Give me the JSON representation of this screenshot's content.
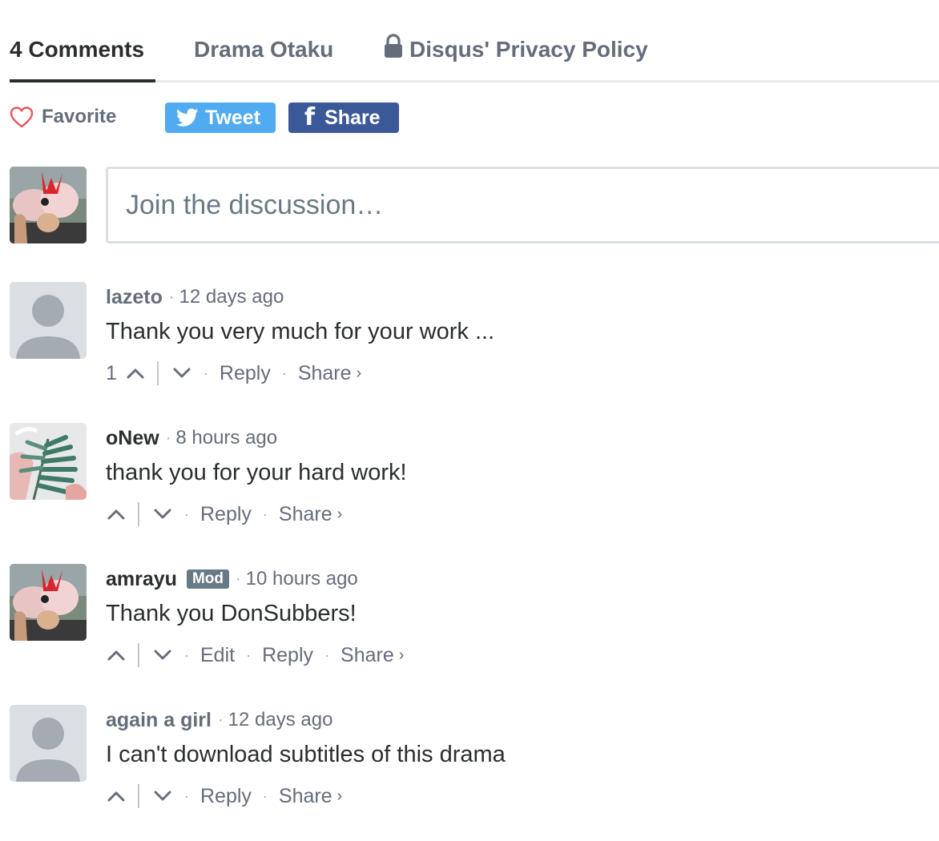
{
  "nav": {
    "comments_tab": "4 Comments",
    "community_tab": "Drama Otaku",
    "privacy_tab": "Disqus' Privacy Policy"
  },
  "actions": {
    "favorite": "Favorite",
    "tweet": "Tweet",
    "share": "Share"
  },
  "composer": {
    "placeholder": "Join the discussion…"
  },
  "comments": [
    {
      "author": "lazeto",
      "time": "12 days ago",
      "body": "Thank you very much for your work ...",
      "votes": "1",
      "reply": "Reply",
      "share": "Share",
      "share_chevron": "›"
    },
    {
      "author": "oNew",
      "time": "8 hours ago",
      "body": "thank you for your hard work!",
      "reply": "Reply",
      "share": "Share",
      "share_chevron": "›"
    },
    {
      "author": "amrayu",
      "badge": "Mod",
      "time": "10 hours ago",
      "body": "Thank you DonSubbers!",
      "edit": "Edit",
      "reply": "Reply",
      "share": "Share",
      "share_chevron": "›"
    },
    {
      "author": "again a girl",
      "time": "12 days ago",
      "body": "I can't download subtitles of this drama",
      "reply": "Reply",
      "share": "Share",
      "share_chevron": "›"
    }
  ],
  "separators": {
    "dot": "·"
  },
  "colors": {
    "tweet_blue": "#50abf1",
    "facebook_blue": "#3b5999",
    "favorite_heart": "#e0585e",
    "mod_badge": "#687a86",
    "muted_text": "#656c7a",
    "primary_text": "#2a2e2e"
  },
  "icons": {
    "favorite": "heart-icon",
    "tweet": "twitter-bird-icon",
    "share": "facebook-f-icon",
    "privacy": "lock-icon",
    "upvote": "chevron-up-icon",
    "downvote": "chevron-down-icon",
    "guest_avatar": "default-user-avatar"
  }
}
